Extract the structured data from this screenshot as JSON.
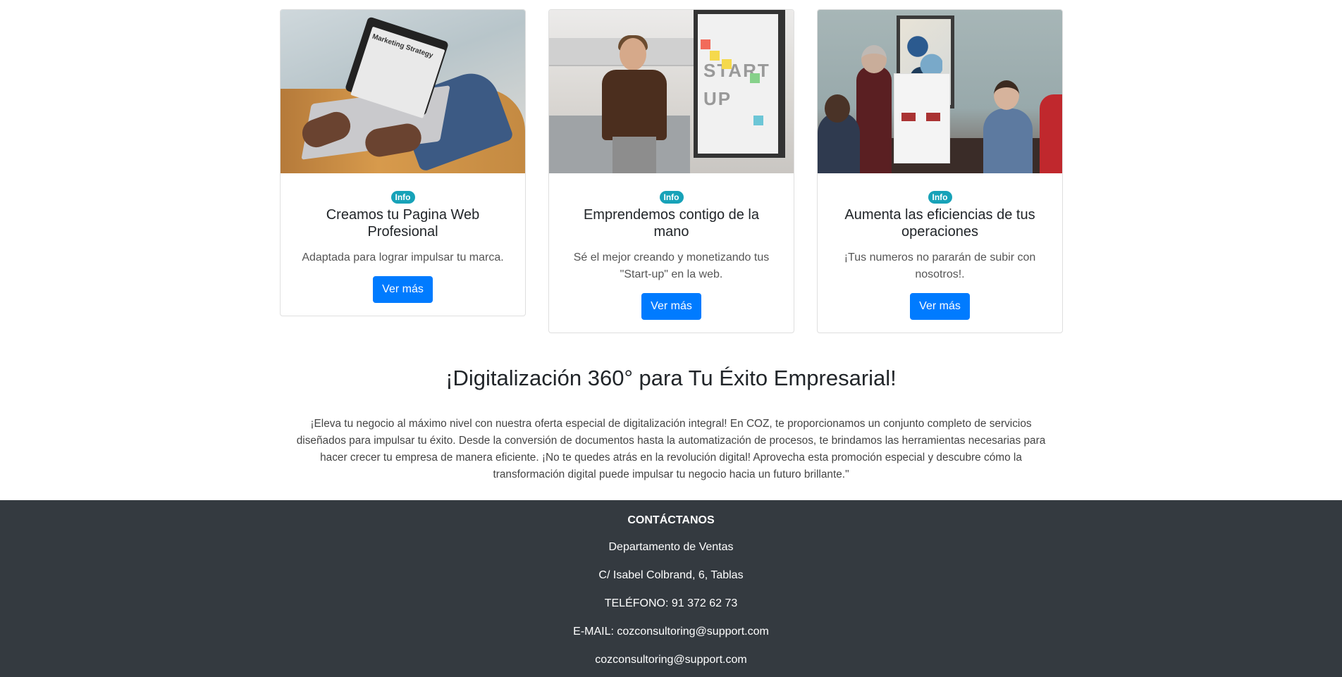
{
  "cards": [
    {
      "badge": "Info",
      "title": "Creamos tu Pagina Web Profesional",
      "text": "Adaptada para lograr impulsar tu marca.",
      "button": "Ver más",
      "image_text": "Marketing Strategy"
    },
    {
      "badge": "Info",
      "title": "Emprendemos contigo de la mano",
      "text": "Sé el mejor creando y monetizando tus \"Start-up\" en la web.",
      "button": "Ver más",
      "image_text": "START UP"
    },
    {
      "badge": "Info",
      "title": "Aumenta las eficiencias de tus operaciones",
      "text": "¡Tus numeros no pararán de subir con nosotros!.",
      "button": "Ver más"
    }
  ],
  "promo": {
    "title": "¡Digitalización 360° para Tu Éxito Empresarial!",
    "text": "¡Eleva tu negocio al máximo nivel con nuestra oferta especial de digitalización integral! En COZ, te proporcionamos un conjunto completo de servicios diseñados para impulsar tu éxito. Desde la conversión de documentos hasta la automatización de procesos, te brindamos las herramientas necesarias para hacer crecer tu empresa de manera eficiente. ¡No te quedes atrás en la revolución digital! Aprovecha esta promoción especial y descubre cómo la transformación digital puede impulsar tu negocio hacia un futuro brillante.\""
  },
  "footer": {
    "title": "CONTÁCTANOS",
    "department": "Departamento de Ventas",
    "address": "C/ Isabel Colbrand, 6, Tablas",
    "phone": "TELÉFONO: 91 372 62 73",
    "email": "E-MAIL: cozconsultoring@support.com",
    "email2": "cozconsultoring@support.com"
  },
  "colors": {
    "primary": "#007bff",
    "info": "#17a2b8",
    "footer_bg": "#343a40"
  }
}
